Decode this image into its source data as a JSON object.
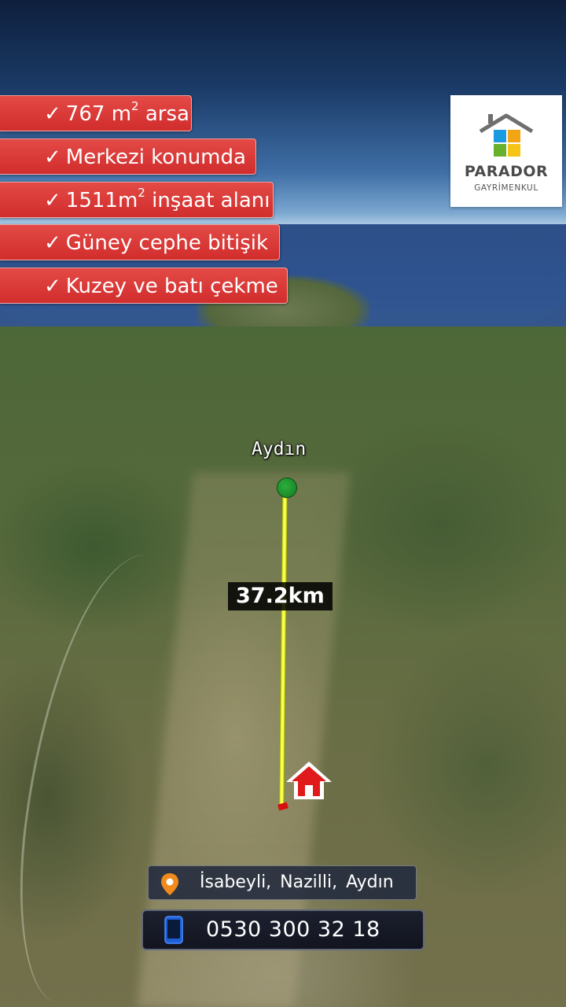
{
  "features": [
    {
      "text": "767 m",
      "sup": "2",
      "suffix": " arsa"
    },
    {
      "text": "Merkezi konumda",
      "sup": "",
      "suffix": ""
    },
    {
      "text": "1511m",
      "sup": "2",
      "suffix": " inşaat alanı"
    },
    {
      "text": "Güney cephe bitişik",
      "sup": "",
      "suffix": ""
    },
    {
      "text": "Kuzey ve batı çekme",
      "sup": "",
      "suffix": ""
    }
  ],
  "check_symbol": "✓",
  "logo": {
    "brand": "PARADOR",
    "sub": "GAYRİMENKUL",
    "colors": [
      "#1a9ae0",
      "#f2a414",
      "#67b12c",
      "#f6c317"
    ]
  },
  "map": {
    "city_label": "Aydın",
    "distance": "37.2km",
    "route_color": "#f4ff3a",
    "start_marker_color": "#1f9a30",
    "destination_icon": "home-icon"
  },
  "contact": {
    "address": "İsabeyli,  Nazilli,  Aydın",
    "address_icon": "location-pin-icon",
    "phone": "0530 300 32 18",
    "phone_icon": "mobile-phone-icon"
  }
}
